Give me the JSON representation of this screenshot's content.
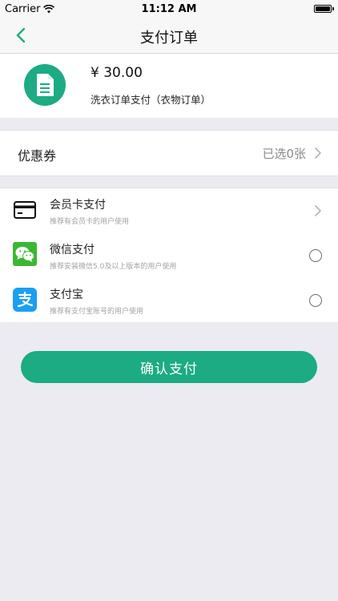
{
  "status_bar": {
    "carrier": "Carrier",
    "time": "11:12 AM"
  },
  "nav": {
    "title": "支付订单",
    "back_icon": "chevron-left-icon"
  },
  "order": {
    "amount": "¥ 30.00",
    "description": "洗衣订单支付（衣物订单）",
    "icon": "document-icon"
  },
  "coupon": {
    "label": "优惠券",
    "value": "已选0张"
  },
  "payment_methods": [
    {
      "name": "会员卡支付",
      "hint": "推荐有会员卡的用户使用",
      "icon": "member-card-icon",
      "control": "chevron"
    },
    {
      "name": "微信支付",
      "hint": "推荐安装微信5.0及以上版本的用户使用",
      "icon": "wechat-icon",
      "control": "radio"
    },
    {
      "name": "支付宝",
      "hint": "推荐有支付宝账号的用户使用",
      "icon": "alipay-icon",
      "control": "radio"
    }
  ],
  "confirm_label": "确认支付",
  "colors": {
    "accent": "#1cab82",
    "background": "#ebebf1",
    "wechat": "#3bb832",
    "alipay": "#1a9ff1"
  }
}
